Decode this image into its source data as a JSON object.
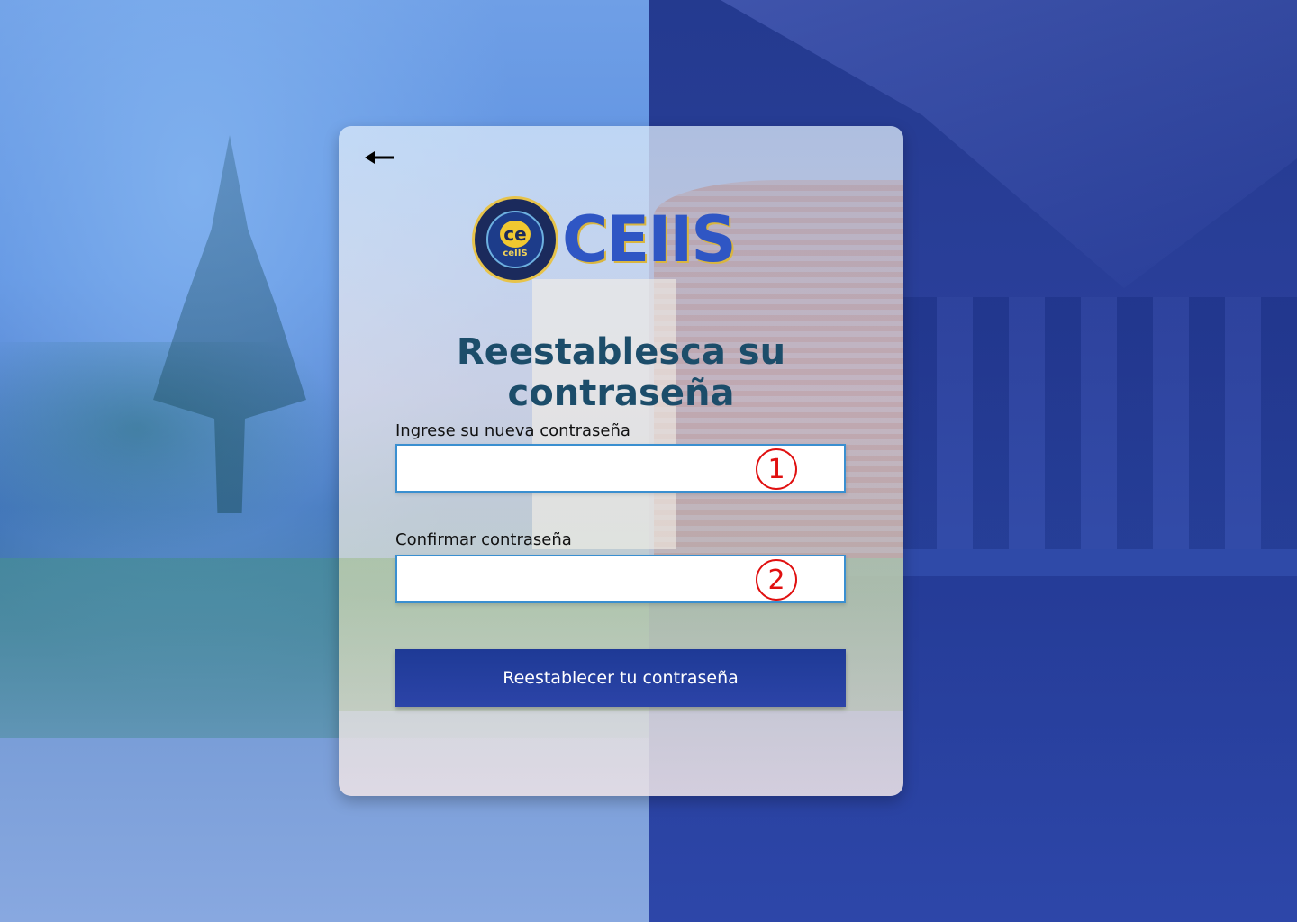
{
  "header": {
    "back_icon": "arrow-left-icon",
    "brand_text": "CEIIS",
    "seal_mark": "ce",
    "seal_sub": "ceIIS"
  },
  "form": {
    "title": "Reestablesca su contraseña",
    "new_password_label": "Ingrese su nueva contraseña",
    "new_password_value": "",
    "new_password_marker": "1",
    "confirm_password_label": "Confirmar contraseña",
    "confirm_password_value": "",
    "confirm_password_marker": "2",
    "submit_label": "Reestablecer tu contraseña"
  },
  "colors": {
    "title": "#1c4d6a",
    "button": "#1e3a96",
    "input_border": "#3a8fd0",
    "marker": "#e01010",
    "bg_right": "#2a3f9a"
  }
}
